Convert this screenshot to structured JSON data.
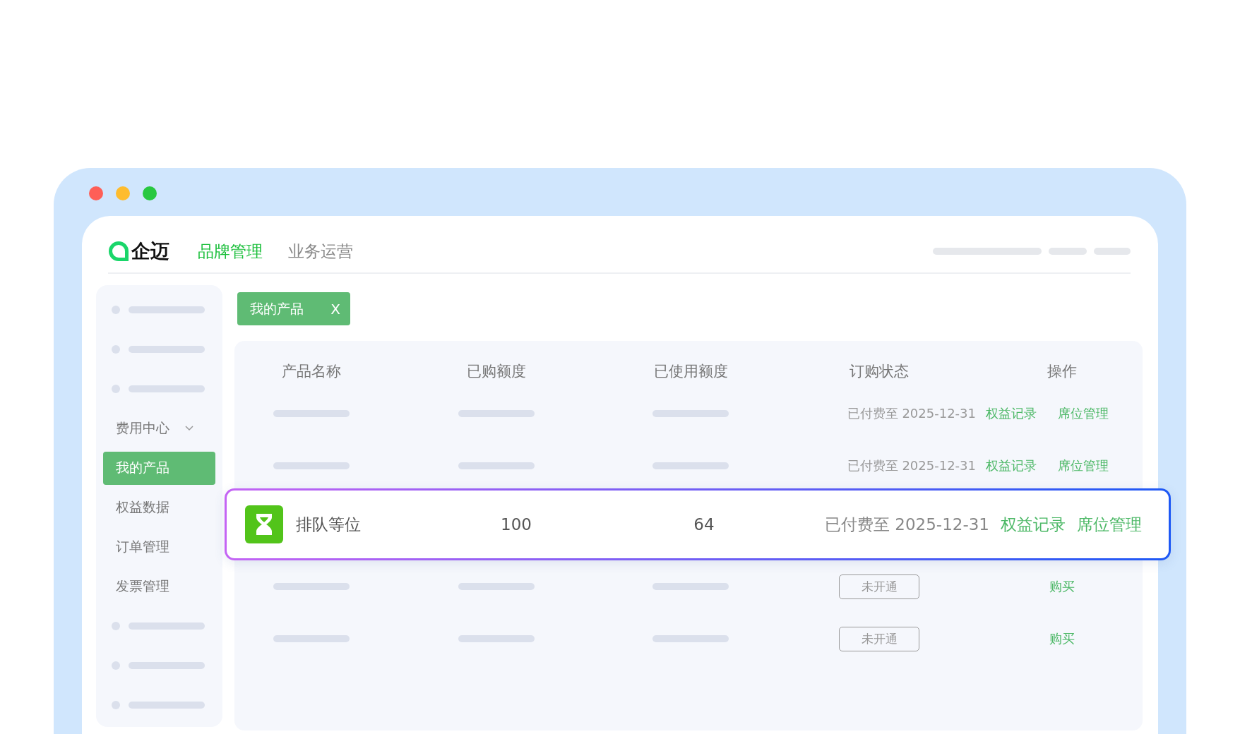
{
  "window": {
    "logo": "企迈"
  },
  "nav_tabs": [
    {
      "label": "品牌管理",
      "selected": true
    },
    {
      "label": "业务运营",
      "selected": false
    }
  ],
  "sidebar": {
    "items": [
      {
        "kind": "placeholder"
      },
      {
        "kind": "placeholder"
      },
      {
        "kind": "placeholder"
      },
      {
        "kind": "group",
        "label": "费用中心",
        "expanded": true
      },
      {
        "kind": "item",
        "label": "我的产品",
        "selected": true
      },
      {
        "kind": "item",
        "label": "权益数据",
        "selected": false
      },
      {
        "kind": "item",
        "label": "订单管理",
        "selected": false
      },
      {
        "kind": "item",
        "label": "发票管理",
        "selected": false
      },
      {
        "kind": "placeholder"
      },
      {
        "kind": "placeholder"
      },
      {
        "kind": "placeholder"
      }
    ]
  },
  "open_tabs": [
    {
      "label": "我的产品",
      "close": "X"
    }
  ],
  "table": {
    "columns": [
      "产品名称",
      "已购额度",
      "已使用额度",
      "订购状态",
      "操作"
    ],
    "rows": [
      {
        "kind": "placeholder",
        "status": {
          "kind": "text",
          "label": "已付费至 2025-12-31"
        },
        "actions": [
          "权益记录",
          "席位管理"
        ]
      },
      {
        "kind": "placeholder",
        "status": {
          "kind": "text",
          "label": "已付费至 2025-12-31"
        },
        "actions": [
          "权益记录",
          "席位管理"
        ]
      },
      {
        "kind": "featured",
        "name": "排队等位",
        "purchased": "100",
        "used": "64",
        "status": {
          "kind": "text",
          "label": "已付费至 2025-12-31"
        },
        "actions": [
          "权益记录",
          "席位管理"
        ]
      },
      {
        "kind": "placeholder",
        "status": {
          "kind": "badge",
          "label": "未开通"
        },
        "actions": [
          "购买"
        ]
      },
      {
        "kind": "placeholder",
        "status": {
          "kind": "badge",
          "label": "未开通"
        },
        "actions": [
          "购买"
        ]
      }
    ]
  }
}
